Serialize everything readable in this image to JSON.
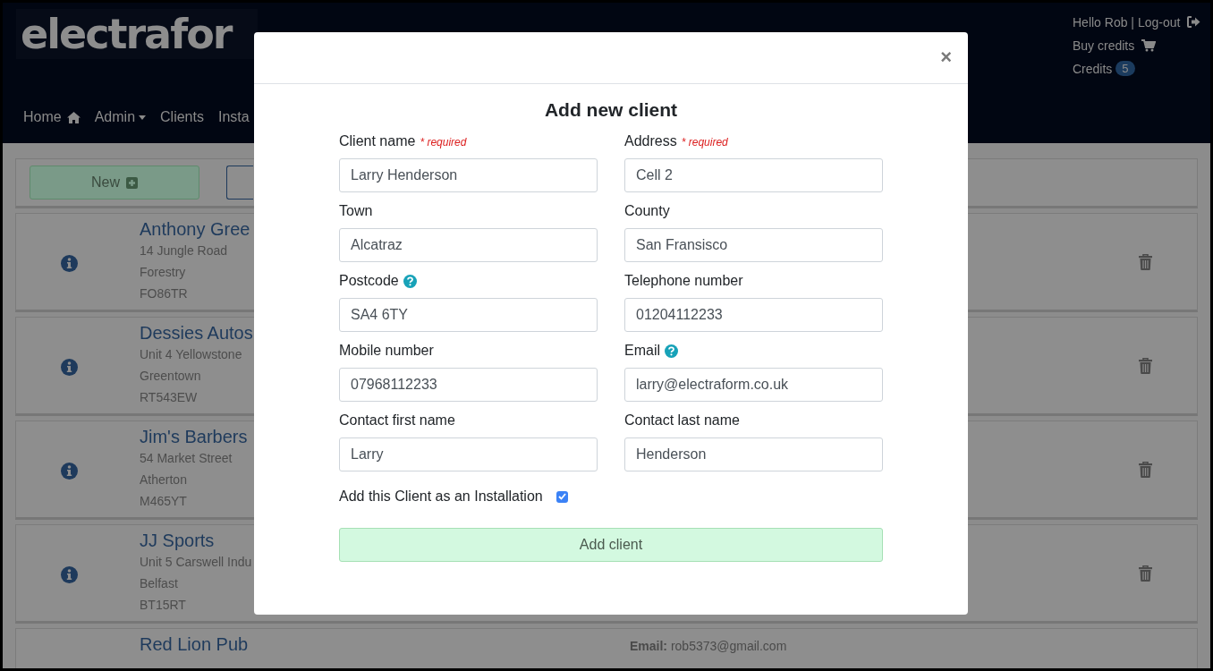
{
  "header": {
    "logo": "electrafor",
    "nav": [
      {
        "label": "Home",
        "kind": "home"
      },
      {
        "label": "Admin",
        "kind": "dropdown"
      },
      {
        "label": "Clients",
        "kind": "plain"
      },
      {
        "label": "Insta",
        "kind": "plain"
      }
    ],
    "user": {
      "greeting": "Hello Rob | Log-out",
      "buy_credits": "Buy credits",
      "credits_label": "Credits",
      "credits": "5"
    }
  },
  "toolbar": {
    "new_button": "New"
  },
  "clients": [
    {
      "name": "Anthony Gree",
      "lines": [
        "14 Jungle Road",
        "Forestry",
        "FO86TR"
      ]
    },
    {
      "name": "Dessies Autos",
      "lines": [
        "Unit 4 Yellowstone",
        "Greentown",
        "RT543EW"
      ]
    },
    {
      "name": "Jim's Barbers",
      "lines": [
        "54 Market Street",
        "Atherton",
        "M465YT"
      ]
    },
    {
      "name": "JJ Sports",
      "lines": [
        "Unit 5 Carswell Indu",
        "Belfast",
        "BT15RT"
      ]
    },
    {
      "name": "Red Lion Pub",
      "details": [
        "**Email:** rob5373@gmail.com"
      ]
    }
  ],
  "modal": {
    "close": "×",
    "title": "Add new client",
    "fields": [
      {
        "label": "Client name",
        "required": "* required",
        "help": false,
        "value": "Larry Henderson"
      },
      {
        "label": "Address",
        "required": "* required",
        "help": false,
        "value": "Cell 2"
      },
      {
        "label": "Town",
        "help": false,
        "value": "Alcatraz"
      },
      {
        "label": "County",
        "help": false,
        "value": "San Fransisco"
      },
      {
        "label": "Postcode",
        "help": true,
        "value": "SA4 6TY"
      },
      {
        "label": "Telephone number",
        "help": false,
        "value": "01204112233"
      },
      {
        "label": "Mobile number",
        "help": false,
        "value": "07968112233"
      },
      {
        "label": "Email",
        "help": true,
        "value": "larry@electraform.co.uk"
      },
      {
        "label": "Contact first name",
        "help": false,
        "value": "Larry"
      },
      {
        "label": "Contact last name",
        "help": false,
        "value": "Henderson"
      }
    ],
    "checkbox": {
      "label": "Add this Client as an Installation",
      "checked": true
    },
    "submit": "Add client"
  }
}
